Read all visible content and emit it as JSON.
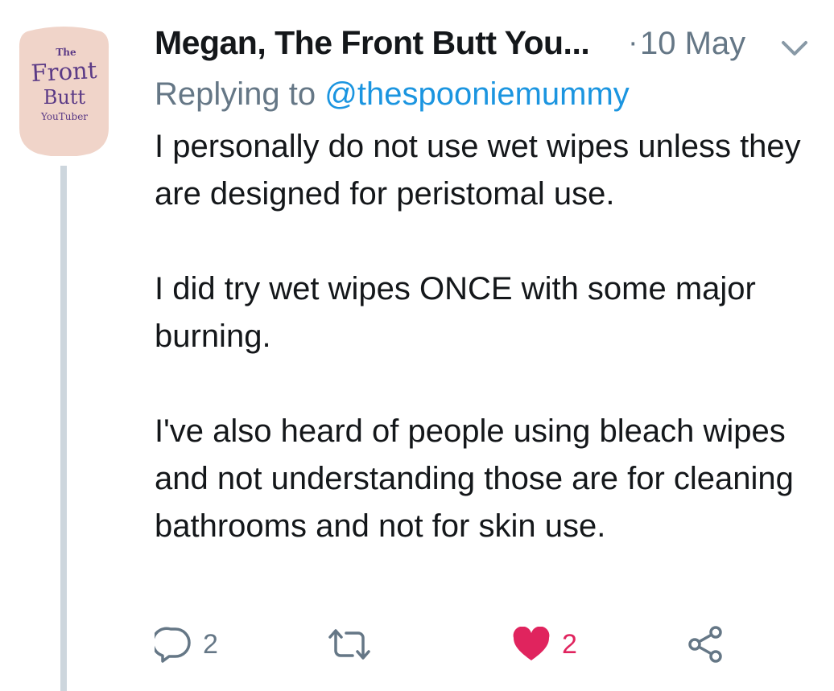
{
  "tweet": {
    "avatar": {
      "line1": "The",
      "line2": "Front",
      "line3": "Butt",
      "line4": "YouTuber",
      "bg_color": "#f0d4c9",
      "text_color": "#5b3a86"
    },
    "author_name": "Megan, The Front Butt You...",
    "separator": "·",
    "date": "10 May",
    "caret_icon": "chevron-down-icon",
    "replying_prefix": "Replying to",
    "replying_handle": "@thespooniemummy",
    "paragraphs": [
      "I personally do not use wet wipes unless they are designed for peristomal use.",
      "I did try wet wipes ONCE with some major burning.",
      "I've also heard of people using bleach wipes and not understanding those are for cleaning bathrooms and not for skin use."
    ],
    "actions": {
      "reply": {
        "icon": "reply-icon",
        "count": "2"
      },
      "retweet": {
        "icon": "retweet-icon"
      },
      "like": {
        "icon": "heart-icon",
        "count": "2",
        "liked": true,
        "color": "#e0245e"
      },
      "share": {
        "icon": "share-icon"
      }
    },
    "colors": {
      "link": "#1b95e0",
      "muted": "#657786",
      "thread_line": "#cdd6dd"
    }
  }
}
